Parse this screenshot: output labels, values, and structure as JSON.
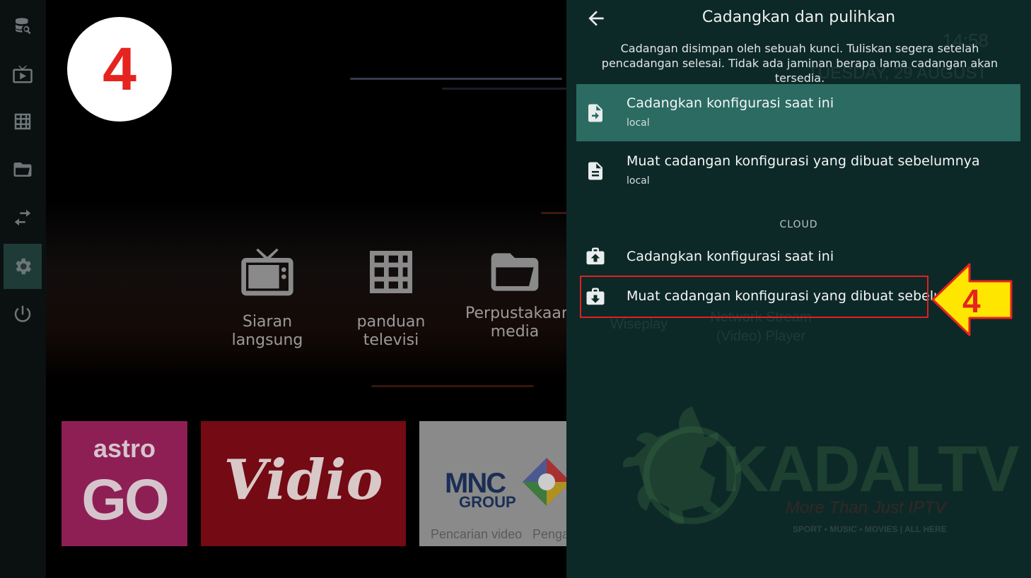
{
  "step_number": "4",
  "sidebar": {
    "items": [
      {
        "icon": "database-search-icon"
      },
      {
        "icon": "tv-icon"
      },
      {
        "icon": "grid-icon"
      },
      {
        "icon": "folder-icon"
      },
      {
        "icon": "transfer-icon"
      },
      {
        "icon": "settings-gear-icon",
        "active": true
      },
      {
        "icon": "power-icon"
      }
    ]
  },
  "home": {
    "nav_tiles": [
      {
        "label": "Siaran langsung",
        "icon": "tv-icon"
      },
      {
        "label": "panduan televisi",
        "icon": "grid-icon"
      },
      {
        "label": "Perpustakaan media",
        "icon": "folder-icon"
      }
    ],
    "apps": {
      "astro": {
        "line1": "astro",
        "line2": "GO"
      },
      "vidio": {
        "label": "Vidio"
      },
      "mnc": {
        "line1": "MNC",
        "line2": "GROUP",
        "cap1": "Pencarian video",
        "cap2": "Pengaturan"
      }
    }
  },
  "background_ghost": {
    "time": "14:58",
    "date": "TUESDAY, 29 AUGUST",
    "app1": "Wiseplay",
    "app2": "Network Stream (Video) Player",
    "brand": "KADALTV",
    "tagline": "More Than Just IPTV",
    "tags": "SPORT • MUSIC • MOVIES | ALL HERE"
  },
  "panel": {
    "title": "Cadangkan dan pulihkan",
    "description": "Cadangan disimpan oleh sebuah kunci. Tuliskan segera setelah pencadangan selesai. Tidak ada jaminan berapa lama cadangan akan tersedia.",
    "local_items": [
      {
        "label": "Cadangkan konfigurasi saat ini",
        "sub": "local",
        "icon": "file-export-icon"
      },
      {
        "label": "Muat cadangan konfigurasi yang dibuat sebelumnya",
        "sub": "local",
        "icon": "file-document-icon"
      }
    ],
    "cloud_section": "CLOUD",
    "cloud_items": [
      {
        "label": "Cadangkan konfigurasi saat ini",
        "icon": "briefcase-upload-icon"
      },
      {
        "label": "Muat cadangan konfigurasi yang dibuat sebelumnya",
        "icon": "briefcase-download-icon"
      }
    ]
  },
  "callout": {
    "label": "4",
    "arrow_color": "#ffe600",
    "border_color": "#e02020",
    "text_color": "#e52420"
  },
  "colors": {
    "panel_bg": "#0d2927",
    "highlight_row": "#2b6b62",
    "rail_bg": "#0b1011",
    "rail_active": "#1f3b37"
  }
}
